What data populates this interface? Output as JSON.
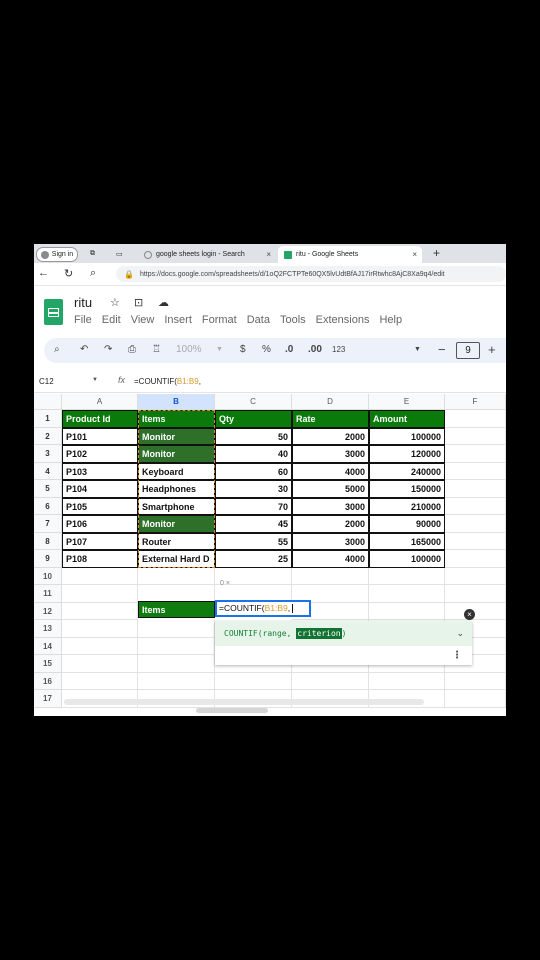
{
  "browser": {
    "signin_label": "Sign in",
    "tabs": [
      {
        "title": "google sheets login - Search",
        "close": "×"
      },
      {
        "title": "ritu - Google Sheets",
        "close": "×"
      }
    ],
    "new_tab": "+",
    "url": "https://docs.google.com/spreadsheets/d/1oQ2FCTPTe60QX5lvUdtBfAJ17irRtwhc8AjC8Xa9q4/edit"
  },
  "doc": {
    "title": "ritu",
    "menu": [
      "File",
      "Edit",
      "View",
      "Insert",
      "Format",
      "Data",
      "Tools",
      "Extensions",
      "Help"
    ]
  },
  "toolbar": {
    "zoom": "100%",
    "currency": "$",
    "percent": "%",
    "dec_decrease": ".0",
    "dec_increase": ".00",
    "number_format": "123",
    "minus": "−",
    "font_size": "9",
    "plus": "+"
  },
  "formula_bar": {
    "name_box": "C12",
    "fx": "fx",
    "formula_prefix": "=COUNTIF(",
    "formula_range": "B1:B9",
    "formula_suffix": ","
  },
  "columns": [
    "A",
    "B",
    "C",
    "D",
    "E",
    "F"
  ],
  "rows": [
    "1",
    "2",
    "3",
    "4",
    "5",
    "6",
    "7",
    "8",
    "9",
    "10",
    "11",
    "12",
    "13",
    "14",
    "15",
    "16",
    "17"
  ],
  "table": {
    "headers": [
      "Product Id",
      "Items",
      "Qty",
      "Rate",
      "Amount"
    ],
    "rows": [
      [
        "P101",
        "Monitor",
        "50",
        "2000",
        "100000"
      ],
      [
        "P102",
        "Monitor",
        "40",
        "3000",
        "120000"
      ],
      [
        "P103",
        "Keyboard",
        "60",
        "4000",
        "240000"
      ],
      [
        "P104",
        "Headphones",
        "30",
        "5000",
        "150000"
      ],
      [
        "P105",
        "Smartphone",
        "70",
        "3000",
        "210000"
      ],
      [
        "P106",
        "Monitor",
        "45",
        "2000",
        "90000"
      ],
      [
        "P107",
        "Router",
        "55",
        "3000",
        "165000"
      ],
      [
        "P108",
        "External Hard D",
        "25",
        "4000",
        "100000"
      ]
    ]
  },
  "criteria_label": "Items",
  "active_cell": {
    "prefix": "=COUNTIF(",
    "range": "B1:B9",
    "suffix": ","
  },
  "tooltip_small": "0 ×",
  "autocomplete": {
    "signature_prefix": "COUNTIF(range, ",
    "current_arg": "criterion",
    "signature_suffix": ")"
  }
}
